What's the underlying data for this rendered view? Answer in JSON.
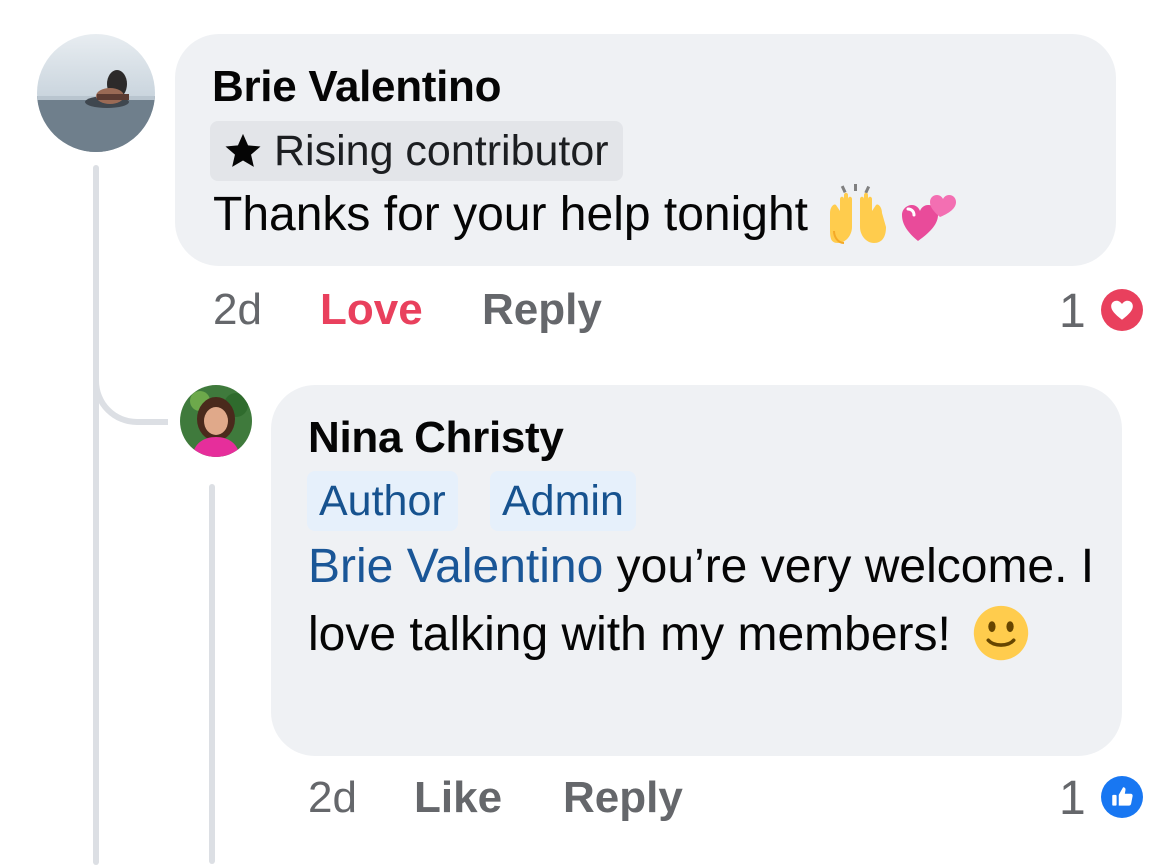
{
  "comment": {
    "author": "Brie Valentino",
    "badge": "Rising contributor",
    "badge_icon": "star-icon",
    "text": "Thanks for your help tonight",
    "emojis": [
      "raising-hands-emoji",
      "revolving-hearts-emoji"
    ],
    "time": "2d",
    "reaction_label": "Love",
    "reply_label": "Reply",
    "reaction_count": "1",
    "reaction_icon": "heart-reaction-icon",
    "reaction_color": "#e9405d"
  },
  "reply": {
    "author": "Nina Christy",
    "badges": [
      "Author",
      "Admin"
    ],
    "mention": "Brie Valentino",
    "text": " you’re very welcome. I love talking with my members!",
    "emoji": "slightly-smiling-face-emoji",
    "time": "2d",
    "like_label": "Like",
    "reply_label": "Reply",
    "reaction_count": "1",
    "reaction_icon": "like-reaction-icon",
    "reaction_color": "#1877f2"
  },
  "colors": {
    "bubble": "#eff1f4",
    "mention": "#1a5697",
    "muted": "#65676b",
    "thread_line": "#dcdfe4"
  }
}
